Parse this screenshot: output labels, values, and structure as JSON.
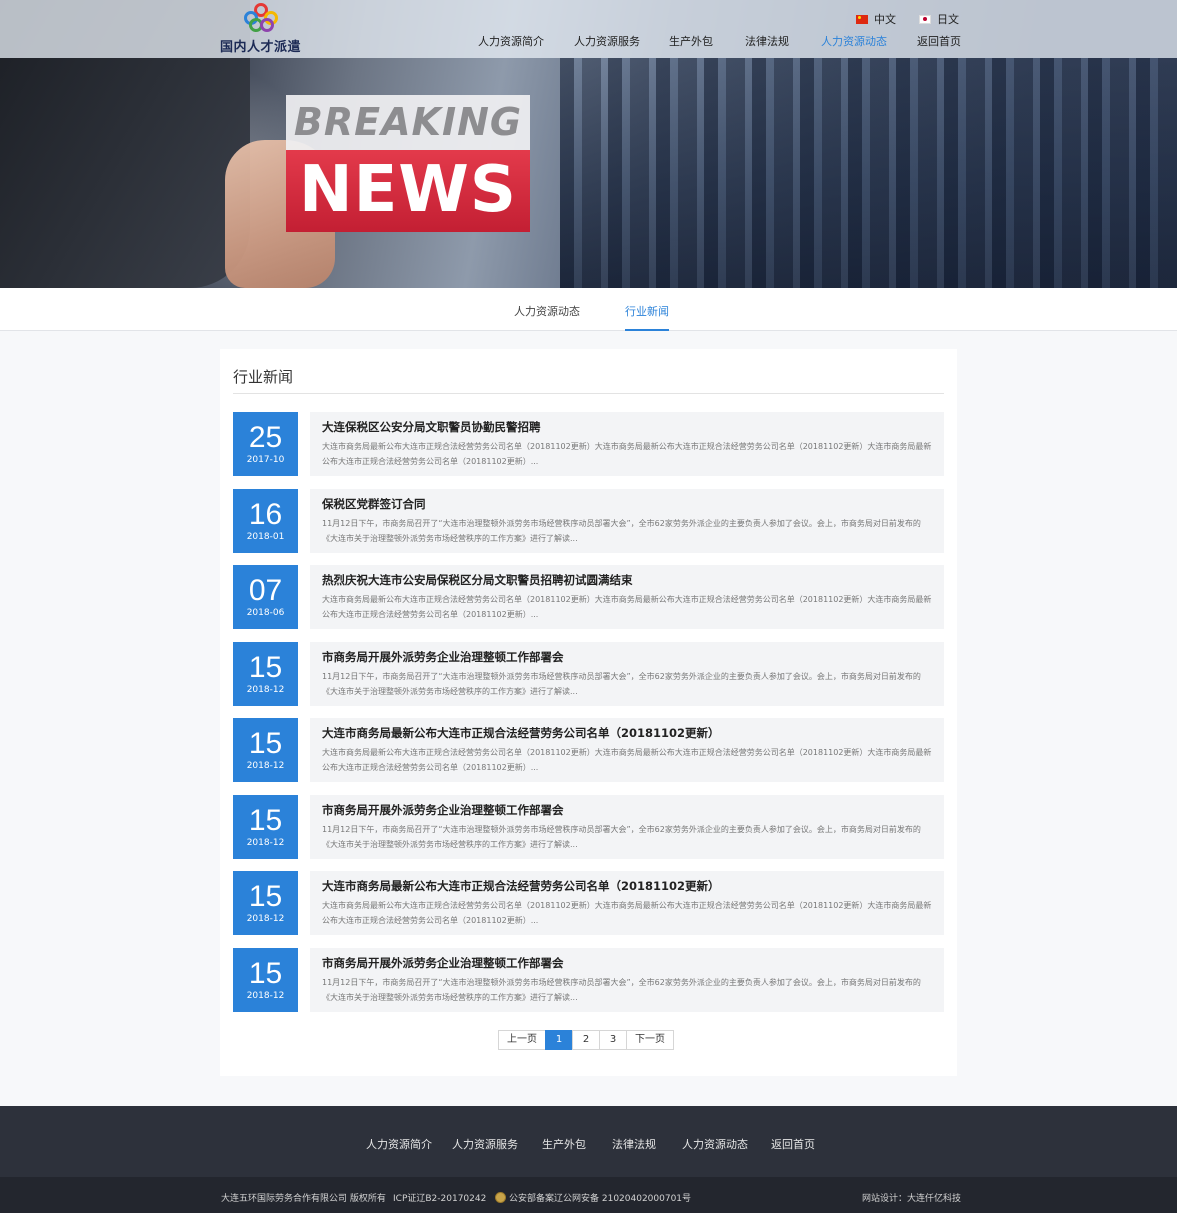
{
  "header": {
    "logo_text": "国内人才派遣",
    "nav": [
      "人力资源简介",
      "人力资源服务",
      "生产外包",
      "法律法规",
      "人力资源动态",
      "返回首页"
    ],
    "nav_active": "人力资源动态",
    "lang_cn": "中文",
    "lang_jp": "日文"
  },
  "banner": {
    "line1": "BREAKING",
    "line2": "NEWS"
  },
  "subtabs": [
    "人力资源动态",
    "行业新闻"
  ],
  "subtab_active": "行业新闻",
  "section_title": "行业新闻",
  "news": [
    {
      "day": "25",
      "ym": "2017-10",
      "title": "大连保税区公安分局文职警员协勤民警招聘",
      "summary": "大连市商务局最新公布大连市正规合法经营劳务公司名单（20181102更新）大连市商务局最新公布大连市正规合法经营劳务公司名单（20181102更新）大连市商务局最新公布大连市正规合法经营劳务公司名单（20181102更新）..."
    },
    {
      "day": "16",
      "ym": "2018-01",
      "title": "保税区党群签订合同",
      "summary": "11月12日下午，市商务局召开了“大连市治理整顿外派劳务市场经营秩序动员部署大会”，全市62家劳务外派企业的主要负责人参加了会议。会上，市商务局对日前发布的《大连市关于治理整顿外派劳务市场经营秩序的工作方案》进行了解读..."
    },
    {
      "day": "07",
      "ym": "2018-06",
      "title": "热烈庆祝大连市公安局保税区分局文职警员招聘初试圆满结束",
      "summary": "大连市商务局最新公布大连市正规合法经营劳务公司名单（20181102更新）大连市商务局最新公布大连市正规合法经营劳务公司名单（20181102更新）大连市商务局最新公布大连市正规合法经营劳务公司名单（20181102更新）..."
    },
    {
      "day": "15",
      "ym": "2018-12",
      "title": "市商务局开展外派劳务企业治理整顿工作部署会",
      "summary": "11月12日下午，市商务局召开了“大连市治理整顿外派劳务市场经营秩序动员部署大会”，全市62家劳务外派企业的主要负责人参加了会议。会上，市商务局对日前发布的《大连市关于治理整顿外派劳务市场经营秩序的工作方案》进行了解读..."
    },
    {
      "day": "15",
      "ym": "2018-12",
      "title": "大连市商务局最新公布大连市正规合法经营劳务公司名单（20181102更新）",
      "summary": "大连市商务局最新公布大连市正规合法经营劳务公司名单（20181102更新）大连市商务局最新公布大连市正规合法经营劳务公司名单（20181102更新）大连市商务局最新公布大连市正规合法经营劳务公司名单（20181102更新）..."
    },
    {
      "day": "15",
      "ym": "2018-12",
      "title": "市商务局开展外派劳务企业治理整顿工作部署会",
      "summary": "11月12日下午，市商务局召开了“大连市治理整顿外派劳务市场经营秩序动员部署大会”，全市62家劳务外派企业的主要负责人参加了会议。会上，市商务局对日前发布的《大连市关于治理整顿外派劳务市场经营秩序的工作方案》进行了解读..."
    },
    {
      "day": "15",
      "ym": "2018-12",
      "title": "大连市商务局最新公布大连市正规合法经营劳务公司名单（20181102更新）",
      "summary": "大连市商务局最新公布大连市正规合法经营劳务公司名单（20181102更新）大连市商务局最新公布大连市正规合法经营劳务公司名单（20181102更新）大连市商务局最新公布大连市正规合法经营劳务公司名单（20181102更新）..."
    },
    {
      "day": "15",
      "ym": "2018-12",
      "title": "市商务局开展外派劳务企业治理整顿工作部署会",
      "summary": "11月12日下午，市商务局召开了“大连市治理整顿外派劳务市场经营秩序动员部署大会”，全市62家劳务外派企业的主要负责人参加了会议。会上，市商务局对日前发布的《大连市关于治理整顿外派劳务市场经营秩序的工作方案》进行了解读..."
    }
  ],
  "pager": {
    "prev": "上一页",
    "pages": [
      "1",
      "2",
      "3"
    ],
    "current": "1",
    "next": "下一页"
  },
  "footer": {
    "nav": [
      "人力资源简介",
      "人力资源服务",
      "生产外包",
      "法律法规",
      "人力资源动态",
      "返回首页"
    ],
    "copyright": "大连五环国际劳务合作有限公司 版权所有",
    "icp": "ICP证辽B2-20170242",
    "police": "公安部备案辽公网安备 21020402000701号",
    "design": "网站设计：大连仟亿科技"
  },
  "colors": {
    "accent": "#2b82d9",
    "footer_bg": "#2d313b",
    "bottom_bg": "#23262e",
    "news_red": "#c31f33"
  }
}
